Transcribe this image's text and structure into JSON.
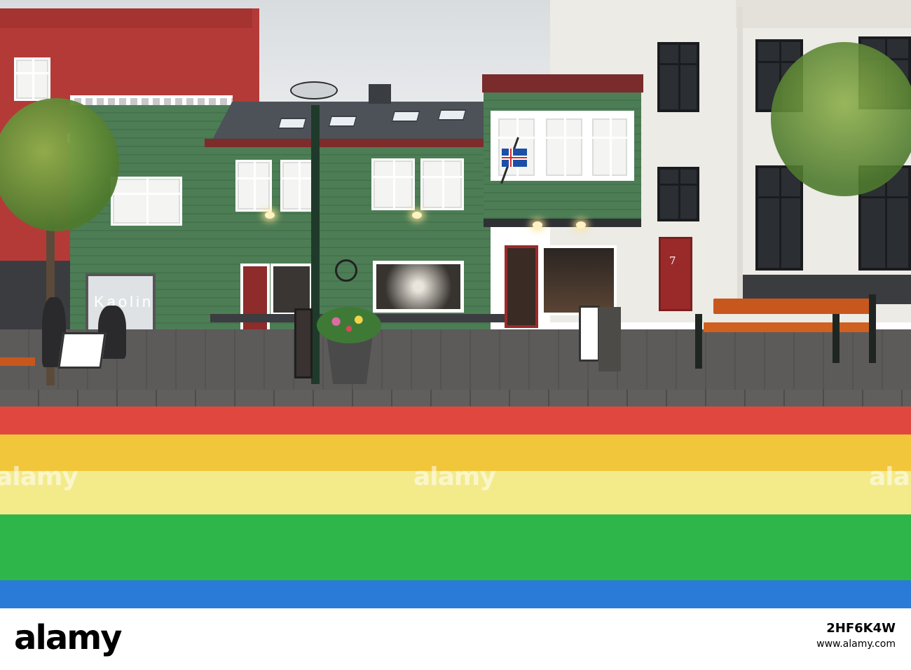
{
  "scene": {
    "shop_sign_text": "Kaolin",
    "house_number": "7",
    "rainbow_colors": [
      "#e0483f",
      "#f2c63a",
      "#f3ea8a",
      "#2fb64a",
      "#2a7ad8"
    ],
    "facade_colors": {
      "red_building": "#b23a36",
      "green_building": "#4c7c55",
      "white_building": "#eceae4"
    }
  },
  "watermark": {
    "text_left": "alamy",
    "text_center": "alamy"
  },
  "footer": {
    "logo": "alamy",
    "image_code": "2HF6K4W",
    "url": "www.alamy.com"
  }
}
